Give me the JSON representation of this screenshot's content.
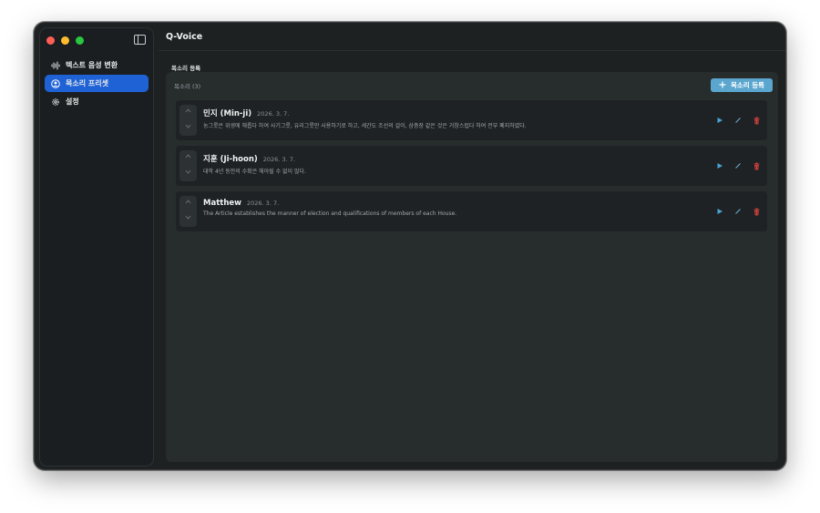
{
  "app": {
    "title": "Q-Voice"
  },
  "sidebar": {
    "items": [
      {
        "label": "텍스트 음성 변환",
        "icon": "waveform-icon",
        "active": false
      },
      {
        "label": "목소리 프리셋",
        "icon": "voice-preset-icon",
        "active": true
      },
      {
        "label": "설정",
        "icon": "gear-icon",
        "active": false
      }
    ]
  },
  "main": {
    "section_label": "목소리 등록",
    "panel": {
      "count_label": "목소리 (3)",
      "add_button_label": "목소리 등록"
    },
    "voices": [
      {
        "name": "민지 (Min-ji)",
        "date": "2026. 3. 7.",
        "description": "농그릇은 위생에 해롭다 하여 사기그릇, 유리그릇만 사용하기로 하고, 세간도 조선의 걸이, 삼층장 같은 것은 거창스럽다 하여 전부 폐지하였다."
      },
      {
        "name": "지훈 (Ji-hoon)",
        "date": "2026. 3. 7.",
        "description": "대학 4년 동안의 수확은 헤아릴 수 없이 많다."
      },
      {
        "name": "Matthew",
        "date": "2026. 3. 7.",
        "description": "The Article establishes the manner of election and qualifications of members of each House."
      }
    ]
  },
  "colors": {
    "accent": "#1f62d6",
    "add_button": "#5aa6cf",
    "play": "#4aa3d6",
    "edit": "#6fb3dc",
    "delete": "#e0443e"
  }
}
